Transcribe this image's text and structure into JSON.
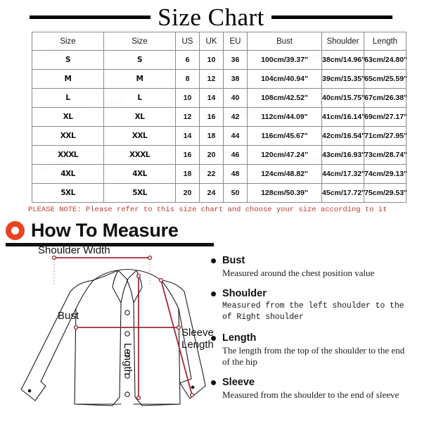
{
  "title": "Size Chart",
  "table": {
    "headers": [
      "Size",
      "Size",
      "US",
      "UK",
      "EU",
      "Bust",
      "Shoulder",
      "Length"
    ],
    "rows": [
      {
        "size1": "S",
        "size2": "S",
        "us": "6",
        "uk": "10",
        "eu": "36",
        "bust": "100cm/39.37\"",
        "shoulder": "38cm/14.96\"",
        "length": "63cm/24.80\""
      },
      {
        "size1": "M",
        "size2": "M",
        "us": "8",
        "uk": "12",
        "eu": "38",
        "bust": "104cm/40.94\"",
        "shoulder": "39cm/15.35\"",
        "length": "65cm/25.59\""
      },
      {
        "size1": "L",
        "size2": "L",
        "us": "10",
        "uk": "14",
        "eu": "40",
        "bust": "108cm/42.52\"",
        "shoulder": "40cm/15.75\"",
        "length": "67cm/26.38\""
      },
      {
        "size1": "XL",
        "size2": "XL",
        "us": "12",
        "uk": "16",
        "eu": "42",
        "bust": "112cm/44.09\"",
        "shoulder": "41cm/16.14\"",
        "length": "69cm/27.17\""
      },
      {
        "size1": "XXL",
        "size2": "XXL",
        "us": "14",
        "uk": "18",
        "eu": "44",
        "bust": "116cm/45.67\"",
        "shoulder": "42cm/16.54\"",
        "length": "71cm/27.95\""
      },
      {
        "size1": "XXXL",
        "size2": "XXXL",
        "us": "16",
        "uk": "20",
        "eu": "46",
        "bust": "120cm/47.24\"",
        "shoulder": "43cm/16.93\"",
        "length": "73cm/28.74\""
      },
      {
        "size1": "4XL",
        "size2": "4XL",
        "us": "18",
        "uk": "22",
        "eu": "48",
        "bust": "124cm/48.82\"",
        "shoulder": "44cm/17.32\"",
        "length": "74cm/29.13\""
      },
      {
        "size1": "5XL",
        "size2": "5XL",
        "us": "20",
        "uk": "24",
        "eu": "50",
        "bust": "128cm/50.39\"",
        "shoulder": "45cm/17.72\"",
        "length": "75cm/29.53\""
      }
    ]
  },
  "please_note": "PLEASE NOTE: Please refer to this size chart and choose your size according to it",
  "how_to_measure": {
    "heading": "How To Measure",
    "items": [
      {
        "title": "Bust",
        "desc": "Measured around the chest position value"
      },
      {
        "title": "Shoulder",
        "desc": "Measured from the left shoulder to the of Right shoulder"
      },
      {
        "title": "Length",
        "desc": "The length from the top of the shoulder to the end of the hip"
      },
      {
        "title": "Sleeve",
        "desc": "Measured from the shoulder to the end of sleeve"
      }
    ]
  },
  "diagram": {
    "labels": {
      "shoulder_width": "Shoulder Width",
      "bust": "Bust",
      "length": "Length",
      "sleeve_length_line1": "Sleeve",
      "sleeve_length_line2": "Length"
    }
  },
  "colors": {
    "measure_line": "#9e2a35",
    "ring_icon": "#e8431f",
    "note_text": "#c0392b",
    "garment_outline": "#1a1a1a",
    "table_border": "#8a8a8a"
  }
}
